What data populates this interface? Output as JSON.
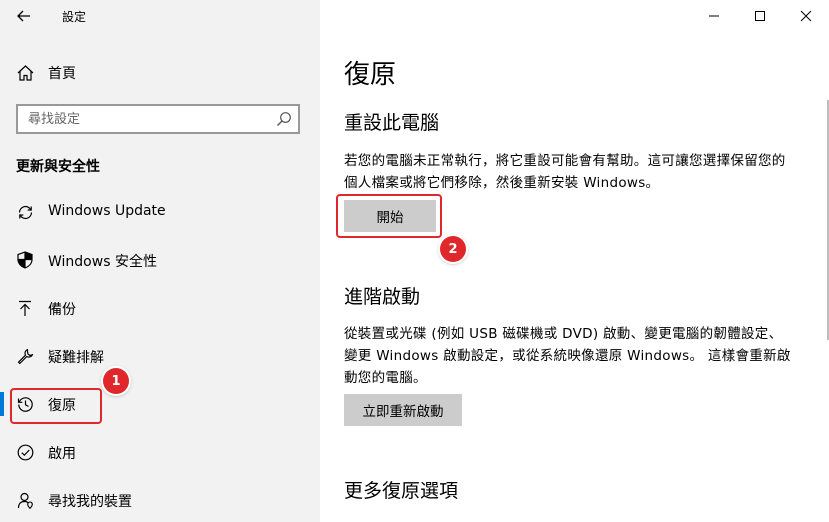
{
  "window": {
    "app_title": "設定"
  },
  "sidebar": {
    "home_label": "首頁",
    "search_placeholder": "尋找設定",
    "section_header": "更新與安全性",
    "items": [
      {
        "label": "Windows Update",
        "icon": "sync-icon",
        "selected": false
      },
      {
        "label": "Windows 安全性",
        "icon": "shield-icon",
        "selected": false
      },
      {
        "label": "備份",
        "icon": "upload-arrow-icon",
        "selected": false
      },
      {
        "label": "疑難排解",
        "icon": "wrench-icon",
        "selected": false
      },
      {
        "label": "復原",
        "icon": "history-icon",
        "selected": true
      },
      {
        "label": "啟用",
        "icon": "check-circle-icon",
        "selected": false
      },
      {
        "label": "尋找我的裝置",
        "icon": "person-pin-icon",
        "selected": false
      }
    ]
  },
  "main": {
    "page_title": "復原",
    "reset": {
      "heading": "重設此電腦",
      "description": "若您的電腦未正常執行，將它重設可能會有幫助。這可讓您選擇保留您的個人檔案或將它們移除，然後重新安裝 Windows。",
      "button_label": "開始"
    },
    "advanced": {
      "heading": "進階啟動",
      "description": "從裝置或光碟 (例如 USB 磁碟機或 DVD) 啟動、變更電腦的韌體設定、變更 Windows 啟動設定，或從系統映像還原 Windows。 這樣會重新啟動您的電腦。",
      "button_label": "立即重新啟動"
    },
    "more": {
      "heading": "更多復原選項"
    }
  },
  "annotations": [
    {
      "label": "1"
    },
    {
      "label": "2"
    }
  ],
  "colors": {
    "accent": "#0078d7",
    "annotation": "#e0282c",
    "sidebar_bg": "#f2f2f2",
    "button_bg": "#cccccc"
  }
}
